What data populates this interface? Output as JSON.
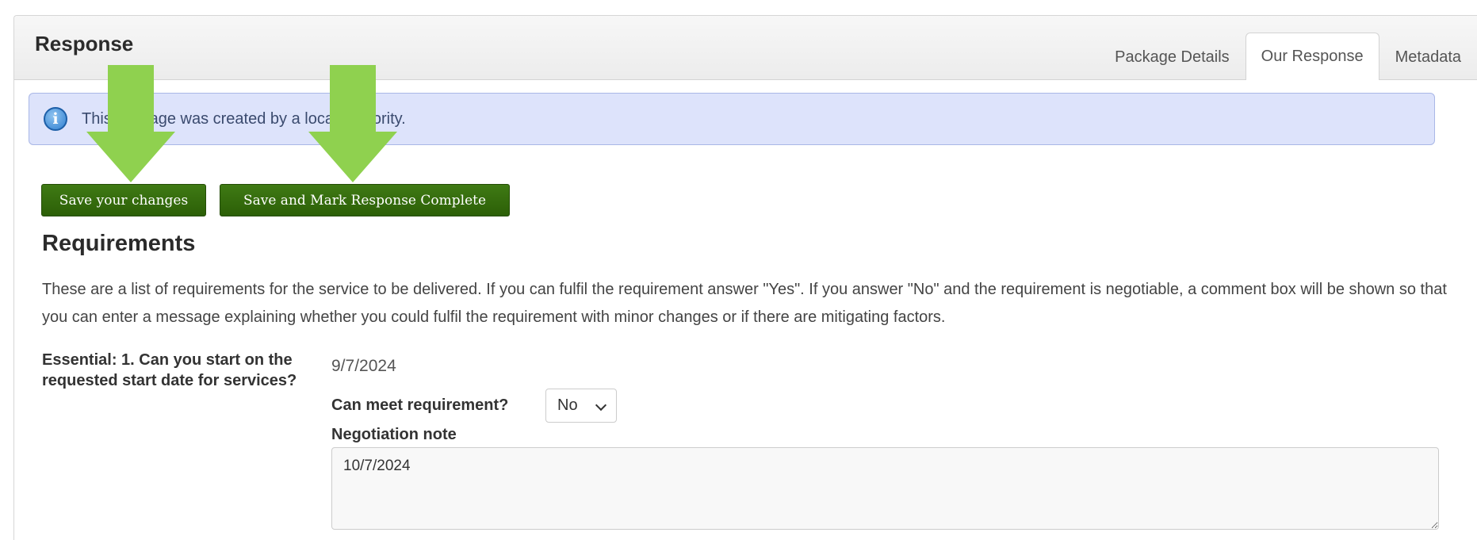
{
  "panel": {
    "title": "Response",
    "tabs": [
      {
        "label": "Package Details",
        "active": false
      },
      {
        "label": "Our Response",
        "active": true
      },
      {
        "label": "Metadata",
        "active": false
      }
    ]
  },
  "alert": {
    "icon": "info-icon",
    "icon_glyph": "i",
    "text": "This package was created by a local authority."
  },
  "actions": {
    "save_label": "Save your changes",
    "complete_label": "Save and Mark Response Complete"
  },
  "requirements": {
    "title": "Requirements",
    "description": "These are a list of requirements for the service to be delivered. If you can fulfil the requirement answer \"Yes\". If you answer \"No\" and the requirement is negotiable, a comment box will be shown so that you can enter a message explaining whether you could fulfil the requirement with minor changes or if there are mitigating factors.",
    "items": [
      {
        "label": "Essential: 1. Can you start on the requested start date for services?",
        "date": "9/7/2024",
        "can_meet_label": "Can meet requirement?",
        "can_meet_value": "No",
        "negotiation_label": "Negotiation note",
        "negotiation_value": "10/7/2024"
      }
    ]
  },
  "colors": {
    "button_green": "#2c5f07",
    "alert_bg": "#dde3fb",
    "annotation_arrow": "#8fd14f"
  }
}
